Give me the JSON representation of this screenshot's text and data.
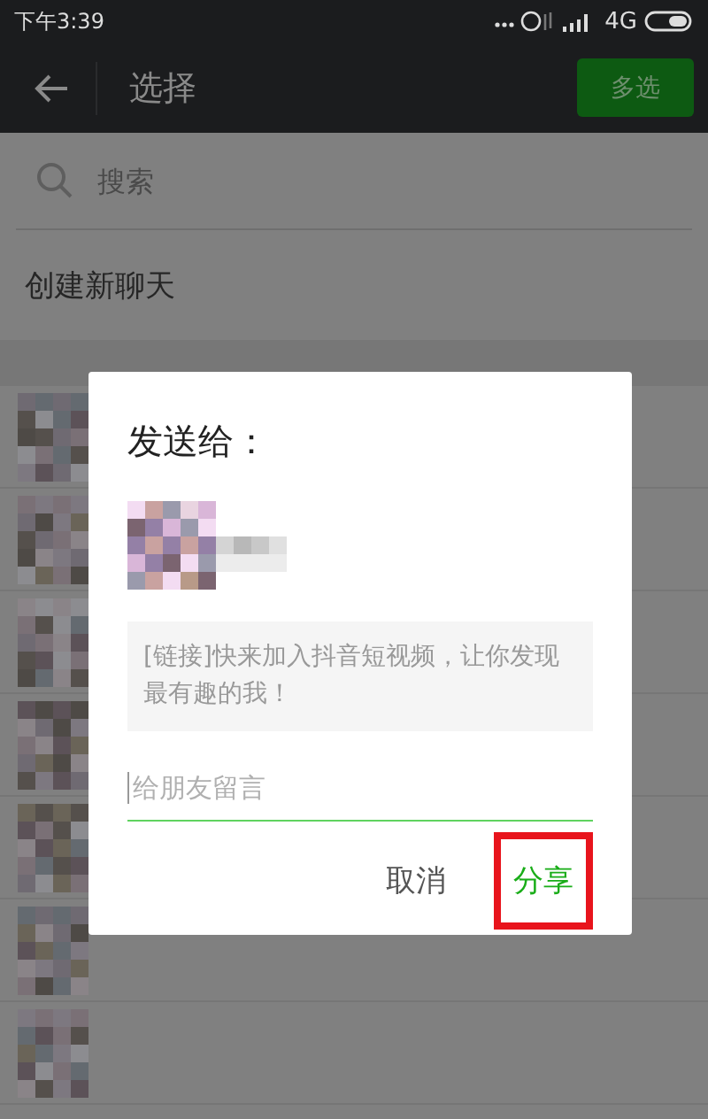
{
  "status_bar": {
    "time": "下午3:39",
    "network": "4G"
  },
  "header": {
    "title": "选择",
    "action": "多选"
  },
  "search": {
    "placeholder": "搜索"
  },
  "new_chat": "创建新聊天",
  "dialog": {
    "title": "发送给：",
    "message": "[链接]快来加入抖音短视频，让你发现最有趣的我！",
    "input": {
      "placeholder": "给朋友留言",
      "focused": true
    },
    "buttons": [
      {
        "label": "取消",
        "kind": "cancel",
        "highlighted": false
      },
      {
        "label": "分享",
        "kind": "confirm",
        "highlighted": true
      }
    ]
  }
}
